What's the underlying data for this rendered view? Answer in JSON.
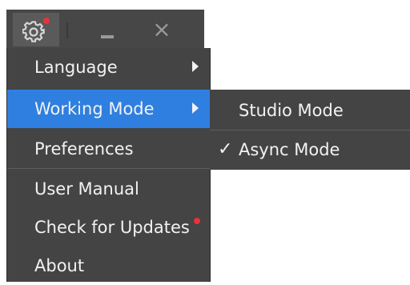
{
  "titlebar": {
    "settings_icon": "gear-icon",
    "minimize_icon": "minimize-icon",
    "close_glyph": "×"
  },
  "menu": {
    "items": [
      {
        "label": "Language",
        "has_submenu": true
      },
      {
        "label": "Working Mode",
        "has_submenu": true,
        "active": true
      },
      {
        "label": "Preferences"
      },
      {
        "label": "User Manual"
      },
      {
        "label": "Check for Updates",
        "notification": true
      },
      {
        "label": "About"
      }
    ]
  },
  "submenu": {
    "items": [
      {
        "label": "Studio Mode",
        "checked": false
      },
      {
        "label": "Async Mode",
        "checked": true
      }
    ],
    "check_glyph": "✓"
  },
  "colors": {
    "menu_bg": "#444444",
    "active_bg": "#2f7fe0",
    "badge": "#e8323c",
    "text": "#f2f2f2"
  }
}
